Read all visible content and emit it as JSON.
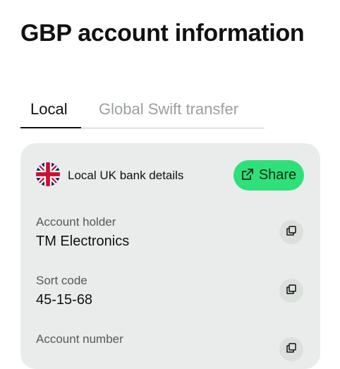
{
  "page": {
    "title": "GBP account information"
  },
  "tabs": [
    {
      "label": "Local",
      "active": true
    },
    {
      "label": "Global Swift transfer",
      "active": false
    }
  ],
  "card": {
    "heading": "Local UK bank details",
    "flag_icon": "uk-flag-icon",
    "share_label": "Share",
    "share_color": "#2fe07a",
    "fields": [
      {
        "label": "Account holder",
        "value": "TM Electronics"
      },
      {
        "label": "Sort code",
        "value": "45-15-68"
      },
      {
        "label": "Account number",
        "value": ""
      }
    ]
  }
}
